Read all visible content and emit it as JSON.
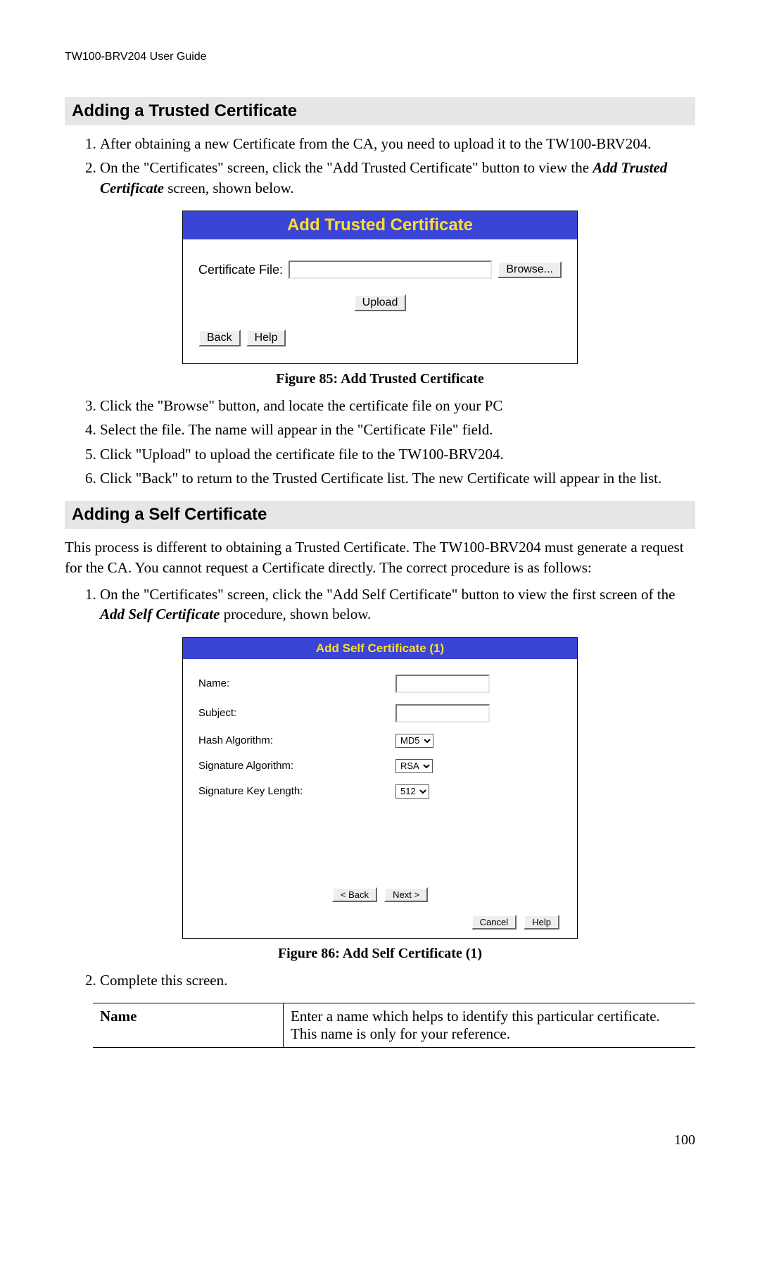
{
  "header": "TW100-BRV204 User Guide",
  "section1": {
    "heading": "Adding a Trusted Certificate",
    "step1": "After obtaining a new Certificate from the CA, you need to upload it to the TW100-BRV204.",
    "step2_a": "On the \"Certificates\" screen, click the \"Add Trusted Certificate\" button to view the ",
    "step2_em": "Add Trusted Certificate",
    "step2_b": " screen, shown below.",
    "step3": "Click the \"Browse\" button, and locate the certificate file on your PC",
    "step4": "Select the file. The name will appear in the \"Certificate File\" field.",
    "step5": "Click \"Upload\" to upload the certificate file to the TW100-BRV204.",
    "step6": "Click \"Back\" to return to the Trusted Certificate list. The new Certificate will appear in the list."
  },
  "fig85": {
    "title": "Add Trusted Certificate",
    "cert_file_label": "Certificate File:",
    "browse": "Browse...",
    "upload": "Upload",
    "back": "Back",
    "help": "Help",
    "caption": "Figure 85: Add Trusted Certificate"
  },
  "section2": {
    "heading": "Adding a Self Certificate",
    "intro": "This process is different to obtaining a Trusted Certificate. The TW100-BRV204 must generate a request for the CA. You cannot request a Certificate directly. The correct procedure is as follows:",
    "step1_a": "On the \"Certificates\" screen, click the \"Add Self Certificate\" button to view the first screen of the ",
    "step1_em": "Add Self Certificate",
    "step1_b": " procedure, shown below.",
    "step2": "Complete this screen."
  },
  "fig86": {
    "title": "Add Self Certificate (1)",
    "name_label": "Name:",
    "subject_label": "Subject:",
    "hash_label": "Hash Algorithm:",
    "hash_value": "MD5",
    "sig_label": "Signature Algorithm:",
    "sig_value": "RSA",
    "keylen_label": "Signature Key Length:",
    "keylen_value": "512",
    "back": "< Back",
    "next": "Next >",
    "cancel": "Cancel",
    "help": "Help",
    "caption": "Figure 86: Add Self  Certificate (1)"
  },
  "defs": {
    "name_term": "Name",
    "name_desc": "Enter a name which helps to identify this particular certificate. This name is only for your reference."
  },
  "page_number": "100"
}
